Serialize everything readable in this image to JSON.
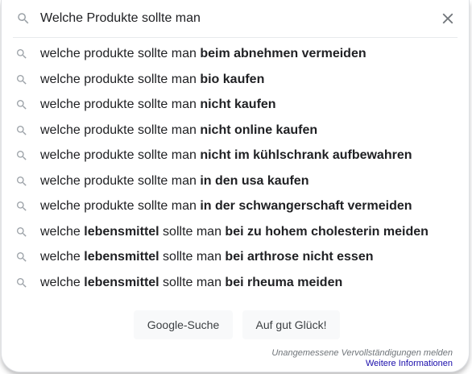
{
  "search": {
    "query": "Welche Produkte sollte man",
    "clear_icon": "close-icon",
    "search_icon": "search-icon"
  },
  "suggestions": [
    {
      "parts": [
        {
          "t": "welche produkte sollte man ",
          "b": false
        },
        {
          "t": "beim abnehmen vermeiden",
          "b": true
        }
      ]
    },
    {
      "parts": [
        {
          "t": "welche produkte sollte man ",
          "b": false
        },
        {
          "t": "bio kaufen",
          "b": true
        }
      ]
    },
    {
      "parts": [
        {
          "t": "welche produkte sollte man ",
          "b": false
        },
        {
          "t": "nicht kaufen",
          "b": true
        }
      ]
    },
    {
      "parts": [
        {
          "t": "welche produkte sollte man ",
          "b": false
        },
        {
          "t": "nicht online kaufen",
          "b": true
        }
      ]
    },
    {
      "parts": [
        {
          "t": "welche produkte sollte man ",
          "b": false
        },
        {
          "t": "nicht im kühlschrank aufbewahren",
          "b": true
        }
      ]
    },
    {
      "parts": [
        {
          "t": "welche produkte sollte man ",
          "b": false
        },
        {
          "t": "in den usa kaufen",
          "b": true
        }
      ]
    },
    {
      "parts": [
        {
          "t": "welche produkte sollte man ",
          "b": false
        },
        {
          "t": "in der schwangerschaft vermeiden",
          "b": true
        }
      ]
    },
    {
      "parts": [
        {
          "t": "welche ",
          "b": false
        },
        {
          "t": "lebensmittel",
          "b": true
        },
        {
          "t": " sollte man ",
          "b": false
        },
        {
          "t": "bei zu hohem cholesterin meiden",
          "b": true
        }
      ]
    },
    {
      "parts": [
        {
          "t": "welche ",
          "b": false
        },
        {
          "t": "lebensmittel",
          "b": true
        },
        {
          "t": " sollte man ",
          "b": false
        },
        {
          "t": "bei arthrose nicht essen",
          "b": true
        }
      ]
    },
    {
      "parts": [
        {
          "t": "welche ",
          "b": false
        },
        {
          "t": "lebensmittel",
          "b": true
        },
        {
          "t": " sollte man ",
          "b": false
        },
        {
          "t": "bei rheuma meiden",
          "b": true
        }
      ]
    }
  ],
  "buttons": {
    "google_search": "Google-Suche",
    "lucky": "Auf gut Glück!"
  },
  "footer": {
    "report": "Unangemessene Vervollständigungen melden",
    "more_info": "Weitere Informationen"
  },
  "colors": {
    "text": "#202124",
    "icon": "#9aa0a6",
    "link": "#1a0dab",
    "muted": "#70757a",
    "button_bg": "#f8f9fa"
  }
}
